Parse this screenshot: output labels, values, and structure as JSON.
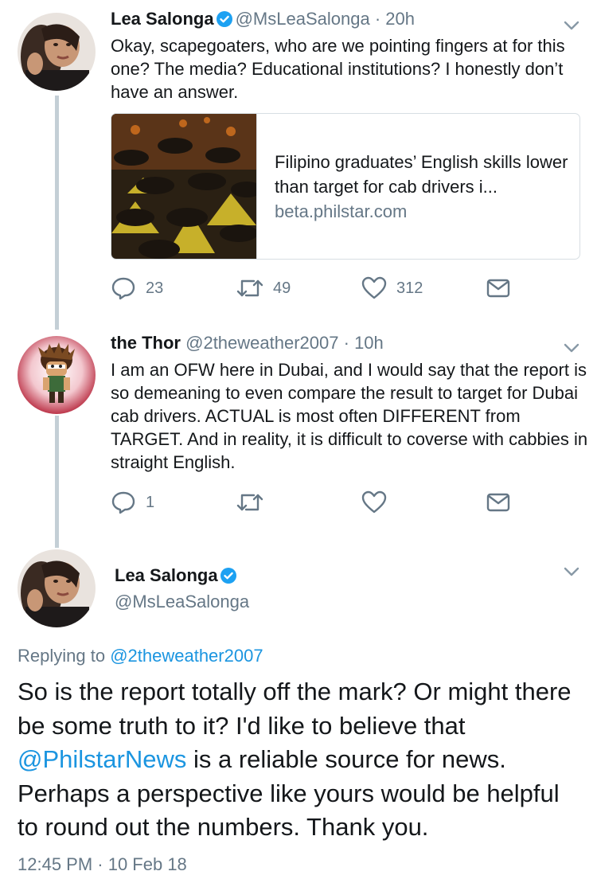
{
  "tweets": [
    {
      "name": "Lea Salonga",
      "handle": "@MsLeaSalonga",
      "time": "20h",
      "text": "Okay, scapegoaters, who are we pointing fingers at for this one? The media? Educational institutions? I honestly don’t have an answer.",
      "card": {
        "title": "Filipino graduates’ English skills lower than target for cab drivers i...",
        "domain": "beta.philstar.com"
      },
      "replies": "23",
      "retweets": "49",
      "likes": "312"
    },
    {
      "name": "the Thor",
      "handle": "@2theweather2007",
      "time": "10h",
      "text": "I am an OFW here in Dubai, and I would say that the report is so demeaning to even compare the result to target for Dubai cab drivers. ACTUAL is most often DIFFERENT from TARGET. And in reality, it is difficult to coverse with cabbies in straight English.",
      "replies": "1",
      "retweets": "",
      "likes": ""
    }
  ],
  "main_tweet": {
    "name": "Lea Salonga",
    "handle": "@MsLeaSalonga",
    "replying_prefix": "Replying to",
    "replying_to": "@2theweather2007",
    "text_part1": "So is the report totally off the mark? Or might there be some truth to it? I'd like to believe that",
    "mention": "@PhilstarNews",
    "text_part2": "is a reliable source for news. Perhaps a perspective like yours would be helpful to round out the numbers. Thank you.",
    "timestamp": "12:45 PM · 10 Feb 18"
  },
  "colors": {
    "link": "#1b95e0",
    "secondary": "#657786",
    "text": "#14171a",
    "verified": "#1da1f2",
    "thread_line": "#c4cfd6"
  },
  "icons": [
    "reply-icon",
    "retweet-icon",
    "like-icon",
    "direct-message-icon",
    "verified-badge-icon",
    "chevron-down-icon"
  ]
}
